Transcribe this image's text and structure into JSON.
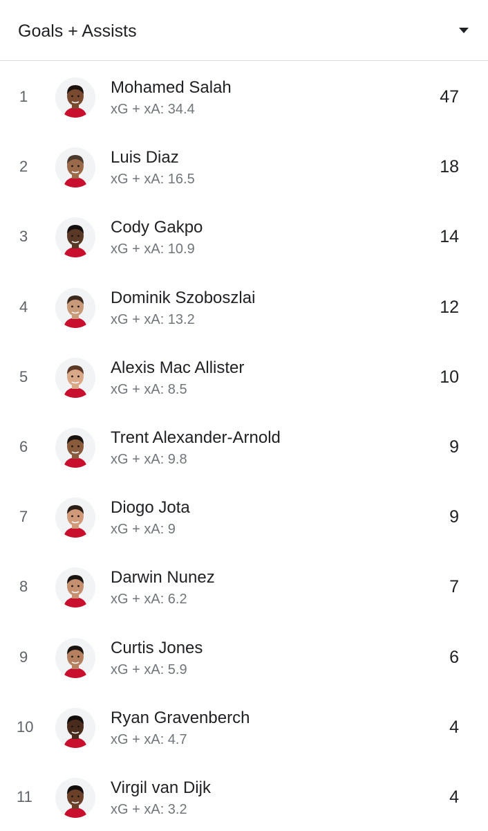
{
  "header": {
    "title": "Goals + Assists",
    "dropdown_icon": "caret-down-icon"
  },
  "players": [
    {
      "rank": "1",
      "name": "Mohamed Salah",
      "sub": "xG + xA: 34.4",
      "value": "47",
      "skin": "#7a4a30",
      "hair": "#1b120d"
    },
    {
      "rank": "2",
      "name": "Luis Diaz",
      "sub": "xG + xA: 16.5",
      "value": "18",
      "skin": "#9a6a4a",
      "hair": "#4a3a2e"
    },
    {
      "rank": "3",
      "name": "Cody Gakpo",
      "sub": "xG + xA: 10.9",
      "value": "14",
      "skin": "#5a3826",
      "hair": "#151010"
    },
    {
      "rank": "4",
      "name": "Dominik Szoboszlai",
      "sub": "xG + xA: 13.2",
      "value": "12",
      "skin": "#c99a7a",
      "hair": "#3b2a1e"
    },
    {
      "rank": "5",
      "name": "Alexis Mac Allister",
      "sub": "xG + xA: 8.5",
      "value": "10",
      "skin": "#d8a888",
      "hair": "#5a3a26"
    },
    {
      "rank": "6",
      "name": "Trent Alexander-Arnold",
      "sub": "xG + xA: 9.8",
      "value": "9",
      "skin": "#8a5a3c",
      "hair": "#1a1410"
    },
    {
      "rank": "7",
      "name": "Diogo Jota",
      "sub": "xG + xA: 9",
      "value": "9",
      "skin": "#d09a7a",
      "hair": "#2a1e16"
    },
    {
      "rank": "8",
      "name": "Darwin Nunez",
      "sub": "xG + xA: 6.2",
      "value": "7",
      "skin": "#c59070",
      "hair": "#1a1410"
    },
    {
      "rank": "9",
      "name": "Curtis Jones",
      "sub": "xG + xA: 5.9",
      "value": "6",
      "skin": "#b58060",
      "hair": "#1a1410"
    },
    {
      "rank": "10",
      "name": "Ryan Gravenberch",
      "sub": "xG + xA: 4.7",
      "value": "4",
      "skin": "#4a2c1c",
      "hair": "#120c0a"
    },
    {
      "rank": "11",
      "name": "Virgil van Dijk",
      "sub": "xG + xA: 3.2",
      "value": "4",
      "skin": "#6a4028",
      "hair": "#120c0a"
    }
  ]
}
